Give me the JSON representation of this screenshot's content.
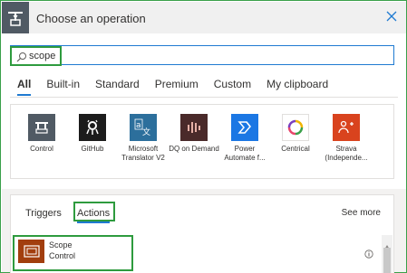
{
  "dialog": {
    "title": "Choose an operation"
  },
  "search": {
    "value": "scope",
    "placeholder": ""
  },
  "tabs": [
    {
      "label": "All",
      "active": true
    },
    {
      "label": "Built-in",
      "active": false
    },
    {
      "label": "Standard",
      "active": false
    },
    {
      "label": "Premium",
      "active": false
    },
    {
      "label": "Custom",
      "active": false
    },
    {
      "label": "My clipboard",
      "active": false
    }
  ],
  "connectors": [
    {
      "name": "Control",
      "icon": "control-icon",
      "color": "#505a64"
    },
    {
      "name": "GitHub",
      "icon": "github-icon",
      "color": "#1c1c1c"
    },
    {
      "name": "Microsoft Translator V2",
      "icon": "translator-icon",
      "color": "#2c6f9c"
    },
    {
      "name": "DQ on Demand",
      "icon": "dq-icon",
      "color": "#4a2a2a"
    },
    {
      "name": "Power Automate f...",
      "icon": "power-automate-icon",
      "color": "#1b77e4"
    },
    {
      "name": "Centrical",
      "icon": "centrical-icon",
      "color": "#ffffff"
    },
    {
      "name": "Strava (Independe...",
      "icon": "strava-icon",
      "color": "#d9431e"
    }
  ],
  "results_tabs": {
    "triggers": "Triggers",
    "actions": "Actions",
    "active": "Actions",
    "see_more": "See more"
  },
  "results": [
    {
      "title": "Scope",
      "connector": "Control",
      "icon": "scope-icon",
      "color": "#a23e0e"
    }
  ]
}
